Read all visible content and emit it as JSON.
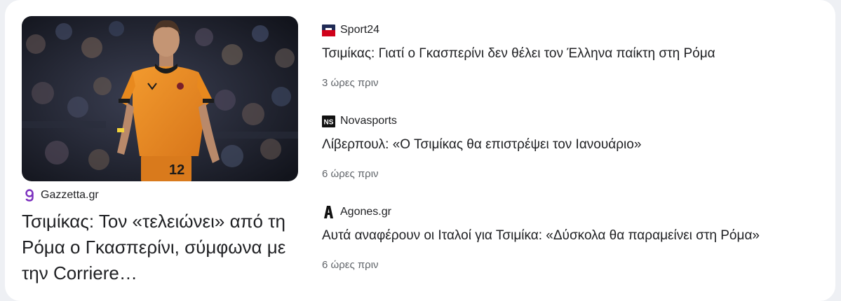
{
  "featured": {
    "source": "Gazzetta.gr",
    "source_logo_icon": "gazzetta-logo-icon",
    "title": "Τσιμίκας: Τον «τελειώνει» από τη Ρόμα ο Γκασπερίνι, σύμφωνα με την Corriere…",
    "image": "football-player-orange-kit-number-12",
    "jersey_number": "12"
  },
  "stories": [
    {
      "source": "Sport24",
      "source_logo_icon": "sport24-logo-icon",
      "title": "Τσιμίκας: Γιατί ο Γκασπερίνι δεν θέλει τον Έλληνα παίκτη στη Ρόμα",
      "time": "3 ώρες πριν"
    },
    {
      "source": "Novasports",
      "source_logo_icon": "novasports-logo-icon",
      "logo_text": "NS",
      "title": "Λίβερπουλ: «Ο Τσιμίκας θα επιστρέψει τον Ιανουάριο»",
      "time": "6 ώρες πριν"
    },
    {
      "source": "Agones.gr",
      "source_logo_icon": "agones-logo-icon",
      "title": "Αυτά αναφέρουν οι Ιταλοί για Τσιμίκα: «Δύσκολα θα παραμείνει στη Ρόμα»",
      "time": "6 ώρες πριν"
    }
  ],
  "colors": {
    "card_background": "#ffffff",
    "page_background": "#eef0f4",
    "title_text": "#202124",
    "time_text": "#5f6368",
    "gazzetta_purple": "#7b2fbe",
    "sport24_red": "#d0021b",
    "sport24_navy": "#1f2a55",
    "jersey_orange": "#e8891e"
  }
}
